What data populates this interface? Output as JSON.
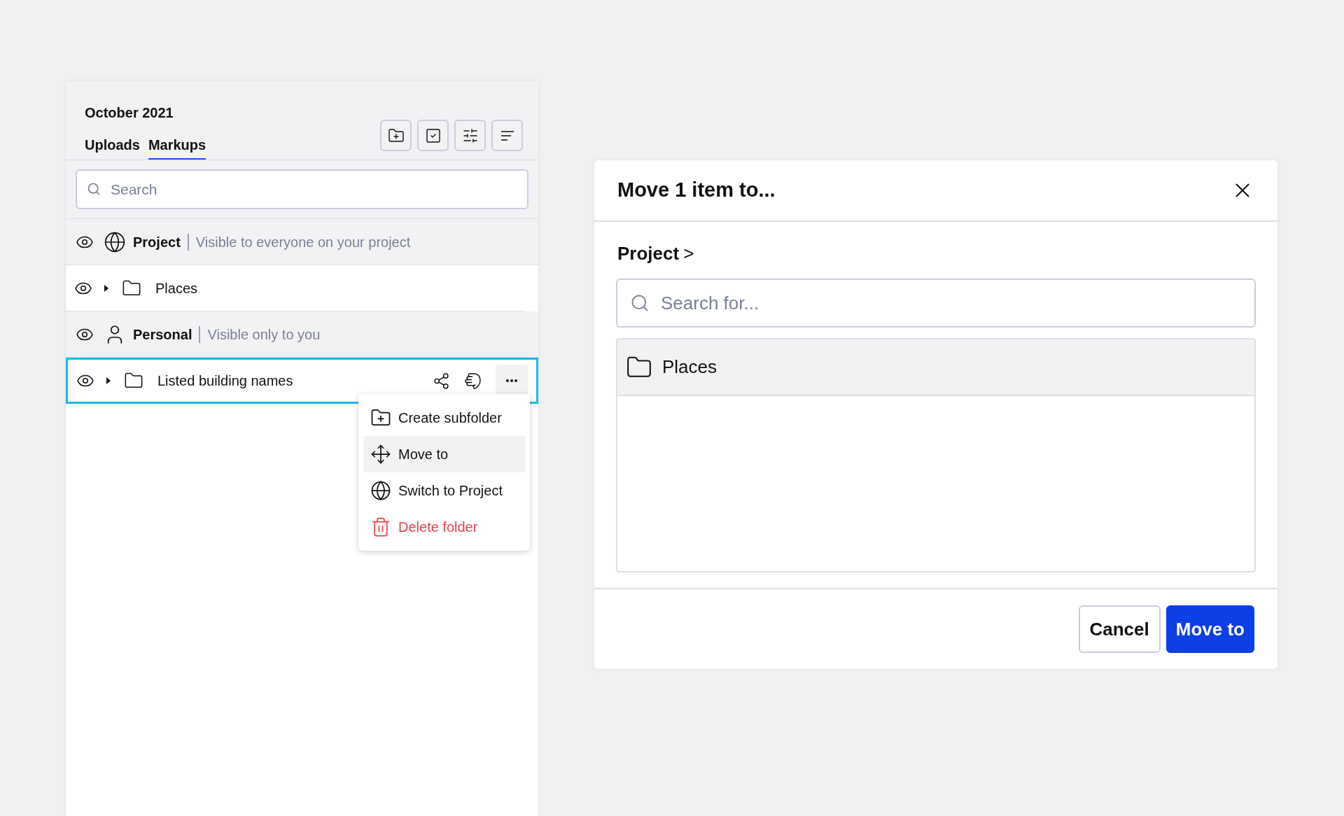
{
  "panel": {
    "title": "October 2021",
    "tabs": [
      {
        "label": "Uploads",
        "selected": false
      },
      {
        "label": "Markups",
        "selected": true
      }
    ],
    "search": {
      "placeholder": "Search"
    },
    "rows": [
      {
        "kind": "group",
        "name": "Project",
        "description": "Visible to everyone on your project"
      },
      {
        "kind": "folder",
        "name": "Places",
        "selected": false
      },
      {
        "kind": "group",
        "name": "Personal",
        "description": "Visible only to you"
      },
      {
        "kind": "folder",
        "name": "Listed building names",
        "selected": true
      }
    ],
    "menu": [
      {
        "kind": "normal",
        "label": "Create subfolder",
        "selected": false
      },
      {
        "kind": "normal",
        "label": "Move to",
        "selected": true
      },
      {
        "kind": "normal",
        "label": "Switch to Project",
        "selected": false
      },
      {
        "kind": "danger",
        "label": "Delete folder",
        "selected": false
      }
    ]
  },
  "dialog": {
    "title": "Move 1 item to...",
    "breadcrumb": "Project",
    "breadcrumb_separator": ">",
    "search": {
      "placeholder": "Search for..."
    },
    "folders": [
      {
        "name": "Places",
        "selected": true
      }
    ],
    "buttons": [
      {
        "kind": "secondary",
        "label": "Cancel"
      },
      {
        "kind": "primary",
        "label": "Move to"
      }
    ]
  }
}
